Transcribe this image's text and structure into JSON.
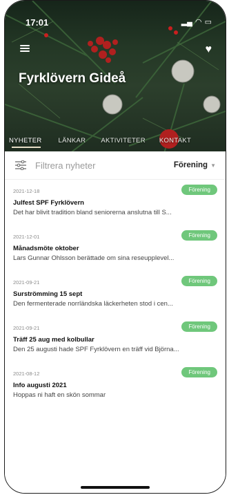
{
  "status_bar": {
    "time": "17:01"
  },
  "header": {
    "title": "Fyrklövern Gideå"
  },
  "tabs": [
    {
      "label": "NYHETER",
      "active": true
    },
    {
      "label": "LÄNKAR",
      "active": false
    },
    {
      "label": "AKTIVITETER",
      "active": false
    },
    {
      "label": "KONTAKT",
      "active": false
    }
  ],
  "filter": {
    "placeholder": "Filtrera nyheter",
    "selected": "Förening"
  },
  "news": [
    {
      "date": "2021-12-18",
      "badge": "Förening",
      "title": "Julfest SPF Fyrklövern",
      "excerpt": "Det har blivit tradition bland seniorerna anslutna till S..."
    },
    {
      "date": "2021-12-01",
      "badge": "Förening",
      "title": "Månadsmöte oktober",
      "excerpt": "Lars Gunnar Ohlsson berättade om sina reseupplevel..."
    },
    {
      "date": "2021-09-21",
      "badge": "Förening",
      "title": "Surströmming 15 sept",
      "excerpt": "Den fermenterade norrländska läckerheten stod i cen..."
    },
    {
      "date": "2021-09-21",
      "badge": "Förening",
      "title": "Träff 25 aug med kolbullar",
      "excerpt": "Den 25 augusti hade SPF Fyrklövern en träff vid Björna..."
    },
    {
      "date": "2021-08-12",
      "badge": "Förening",
      "title": "Info augusti 2021",
      "excerpt": "Hoppas ni haft en skön sommar"
    }
  ],
  "colors": {
    "accent": "#6fc77b",
    "header_bg": "#243826"
  },
  "icons": [
    "menu-icon",
    "heart-icon",
    "filter-icon",
    "signal-icon",
    "wifi-icon",
    "battery-icon"
  ]
}
